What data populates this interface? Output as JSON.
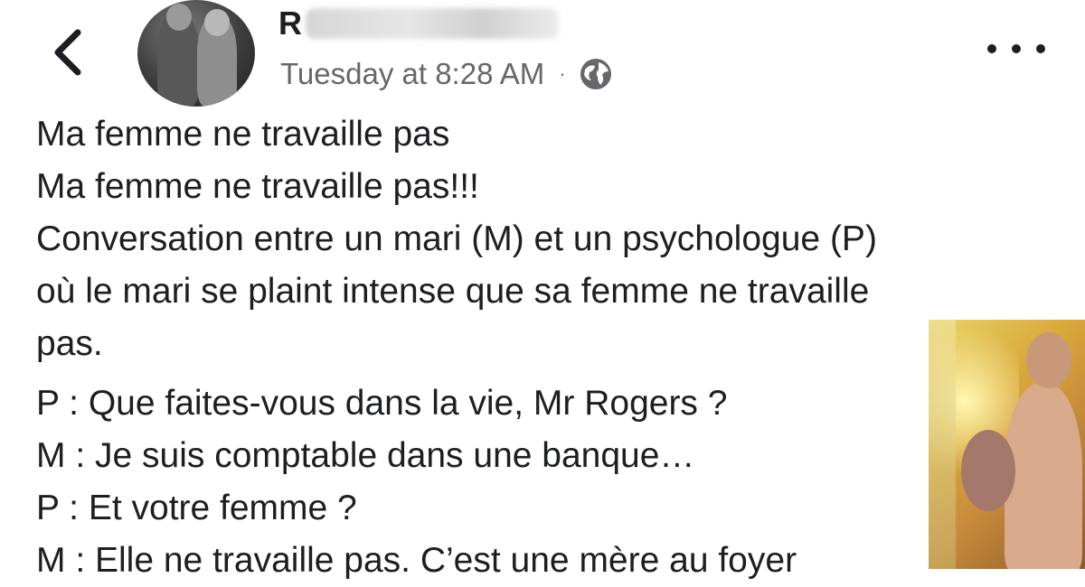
{
  "header": {
    "back_icon": "chevron-left-icon",
    "author_initial": "R",
    "timestamp": "Tuesday at 8:28 AM",
    "separator": "·",
    "audience_icon": "globe-icon",
    "more_icon": "more-horizontal-icon"
  },
  "post": {
    "lines": [
      "Ma femme ne travaille pas",
      "Ma femme ne travaille pas!!!",
      "Conversation entre un mari (M) et un psychologue (P)",
      "où le mari se plaint intense que sa femme ne travaille",
      "pas.",
      "P : Que faites-vous dans la vie, Mr Rogers ?",
      "M : Je suis comptable dans une banque…",
      "P : Et votre femme ?",
      "M : Elle ne travaille pas. C’est une mère au foyer"
    ]
  },
  "colors": {
    "text": "#1c1e21",
    "secondary": "#65676b"
  }
}
